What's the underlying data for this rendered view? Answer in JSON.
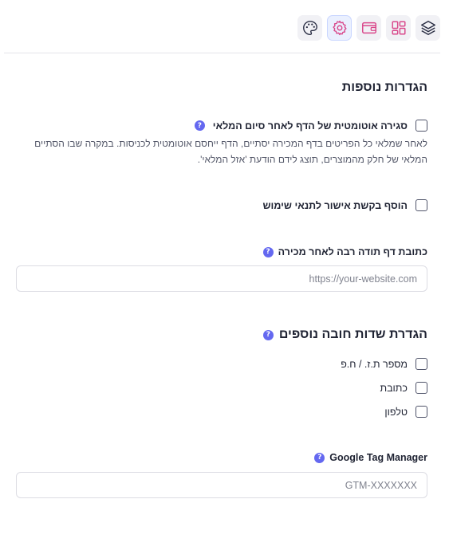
{
  "toolbar": {
    "items": [
      {
        "icon": "layers-icon"
      },
      {
        "icon": "layout-icon"
      },
      {
        "icon": "wallet-icon"
      },
      {
        "icon": "settings-icon",
        "active": true
      },
      {
        "icon": "palette-icon"
      }
    ]
  },
  "additional_settings": {
    "title": "הגדרות נוספות",
    "auto_close": {
      "label": "סגירה אוטומטית של הדף לאחר סיום המלאי",
      "help": "?",
      "checked": false,
      "description": "לאחר שמלאי כל הפריטים בדף המכירה יסתיים, הדף ייחסם אוטומטית לכניסות. במקרה שבו הסתיים המלאי של חלק מהמוצרים, תוצג לידם הודעת 'אזל המלאי'."
    },
    "terms_approval": {
      "label": "הוסף בקשת אישור לתנאי שימוש",
      "checked": false
    },
    "thank_you_url": {
      "label": "כתובת דף תודה רבה לאחר מכירה",
      "help": "?",
      "placeholder": "https://your-website.com",
      "value": ""
    }
  },
  "required_fields": {
    "title": "הגדרת שדות חובה נוספים",
    "help": "?",
    "options": [
      {
        "label": "מספר ת.ז. / ח.פ",
        "checked": false
      },
      {
        "label": "כתובת",
        "checked": false
      },
      {
        "label": "טלפון",
        "checked": false
      }
    ]
  },
  "gtm": {
    "label": "Google Tag Manager",
    "help": "?",
    "placeholder": "GTM-XXXXXXX",
    "value": ""
  }
}
